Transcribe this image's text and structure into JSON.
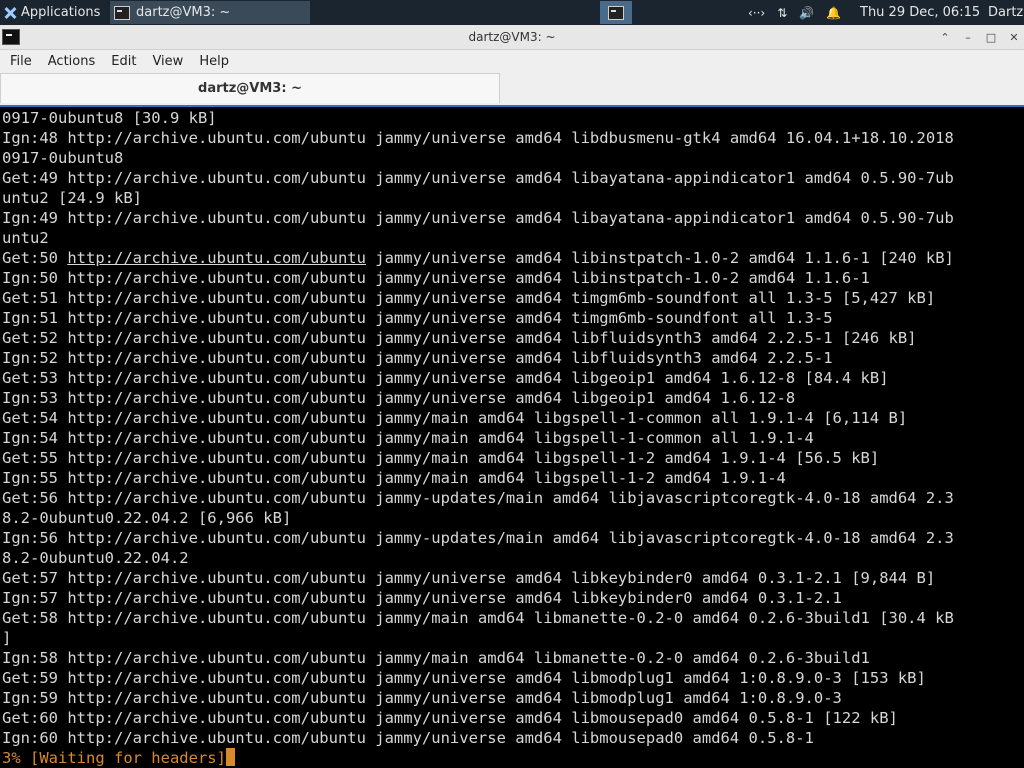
{
  "panel": {
    "applications_label": "Applications",
    "task_label": "dartz@VM3: ~",
    "clock": "Thu 29 Dec, 06:15",
    "user": "Dartz"
  },
  "window": {
    "title": "dartz@VM3: ~"
  },
  "menu": [
    "File",
    "Actions",
    "Edit",
    "View",
    "Help"
  ],
  "tab": {
    "label": "dartz@VM3: ~"
  },
  "terminal": {
    "lines": [
      "0917-0ubuntu8 [30.9 kB]",
      "Ign:48 http://archive.ubuntu.com/ubuntu jammy/universe amd64 libdbusmenu-gtk4 amd64 16.04.1+18.10.2018",
      "0917-0ubuntu8",
      "Get:49 http://archive.ubuntu.com/ubuntu jammy/universe amd64 libayatana-appindicator1 amd64 0.5.90-7ub",
      "untu2 [24.9 kB]",
      "Ign:49 http://archive.ubuntu.com/ubuntu jammy/universe amd64 libayatana-appindicator1 amd64 0.5.90-7ub",
      "untu2",
      "Get:50 http://archive.ubuntu.com/ubuntu jammy/universe amd64 libinstpatch-1.0-2 amd64 1.1.6-1 [240 kB]",
      "Ign:50 http://archive.ubuntu.com/ubuntu jammy/universe amd64 libinstpatch-1.0-2 amd64 1.1.6-1",
      "Get:51 http://archive.ubuntu.com/ubuntu jammy/universe amd64 timgm6mb-soundfont all 1.3-5 [5,427 kB]",
      "Ign:51 http://archive.ubuntu.com/ubuntu jammy/universe amd64 timgm6mb-soundfont all 1.3-5",
      "Get:52 http://archive.ubuntu.com/ubuntu jammy/universe amd64 libfluidsynth3 amd64 2.2.5-1 [246 kB]",
      "Ign:52 http://archive.ubuntu.com/ubuntu jammy/universe amd64 libfluidsynth3 amd64 2.2.5-1",
      "Get:53 http://archive.ubuntu.com/ubuntu jammy/universe amd64 libgeoip1 amd64 1.6.12-8 [84.4 kB]",
      "Ign:53 http://archive.ubuntu.com/ubuntu jammy/universe amd64 libgeoip1 amd64 1.6.12-8",
      "Get:54 http://archive.ubuntu.com/ubuntu jammy/main amd64 libgspell-1-common all 1.9.1-4 [6,114 B]",
      "Ign:54 http://archive.ubuntu.com/ubuntu jammy/main amd64 libgspell-1-common all 1.9.1-4",
      "Get:55 http://archive.ubuntu.com/ubuntu jammy/main amd64 libgspell-1-2 amd64 1.9.1-4 [56.5 kB]",
      "Ign:55 http://archive.ubuntu.com/ubuntu jammy/main amd64 libgspell-1-2 amd64 1.9.1-4",
      "Get:56 http://archive.ubuntu.com/ubuntu jammy-updates/main amd64 libjavascriptcoregtk-4.0-18 amd64 2.3",
      "8.2-0ubuntu0.22.04.2 [6,966 kB]",
      "Ign:56 http://archive.ubuntu.com/ubuntu jammy-updates/main amd64 libjavascriptcoregtk-4.0-18 amd64 2.3",
      "8.2-0ubuntu0.22.04.2",
      "Get:57 http://archive.ubuntu.com/ubuntu jammy/universe amd64 libkeybinder0 amd64 0.3.1-2.1 [9,844 B]",
      "Ign:57 http://archive.ubuntu.com/ubuntu jammy/universe amd64 libkeybinder0 amd64 0.3.1-2.1",
      "Get:58 http://archive.ubuntu.com/ubuntu jammy/main amd64 libmanette-0.2-0 amd64 0.2.6-3build1 [30.4 kB",
      "]",
      "Ign:58 http://archive.ubuntu.com/ubuntu jammy/main amd64 libmanette-0.2-0 amd64 0.2.6-3build1",
      "Get:59 http://archive.ubuntu.com/ubuntu jammy/universe amd64 libmodplug1 amd64 1:0.8.9.0-3 [153 kB]",
      "Ign:59 http://archive.ubuntu.com/ubuntu jammy/universe amd64 libmodplug1 amd64 1:0.8.9.0-3",
      "Get:60 http://archive.ubuntu.com/ubuntu jammy/universe amd64 libmousepad0 amd64 0.5.8-1 [122 kB]",
      "Ign:60 http://archive.ubuntu.com/ubuntu jammy/universe amd64 libmousepad0 amd64 0.5.8-1"
    ],
    "progress": "3% [Waiting for headers]",
    "link_line_index": 7,
    "link_text": "http://archive.ubuntu.com/ubuntu"
  }
}
